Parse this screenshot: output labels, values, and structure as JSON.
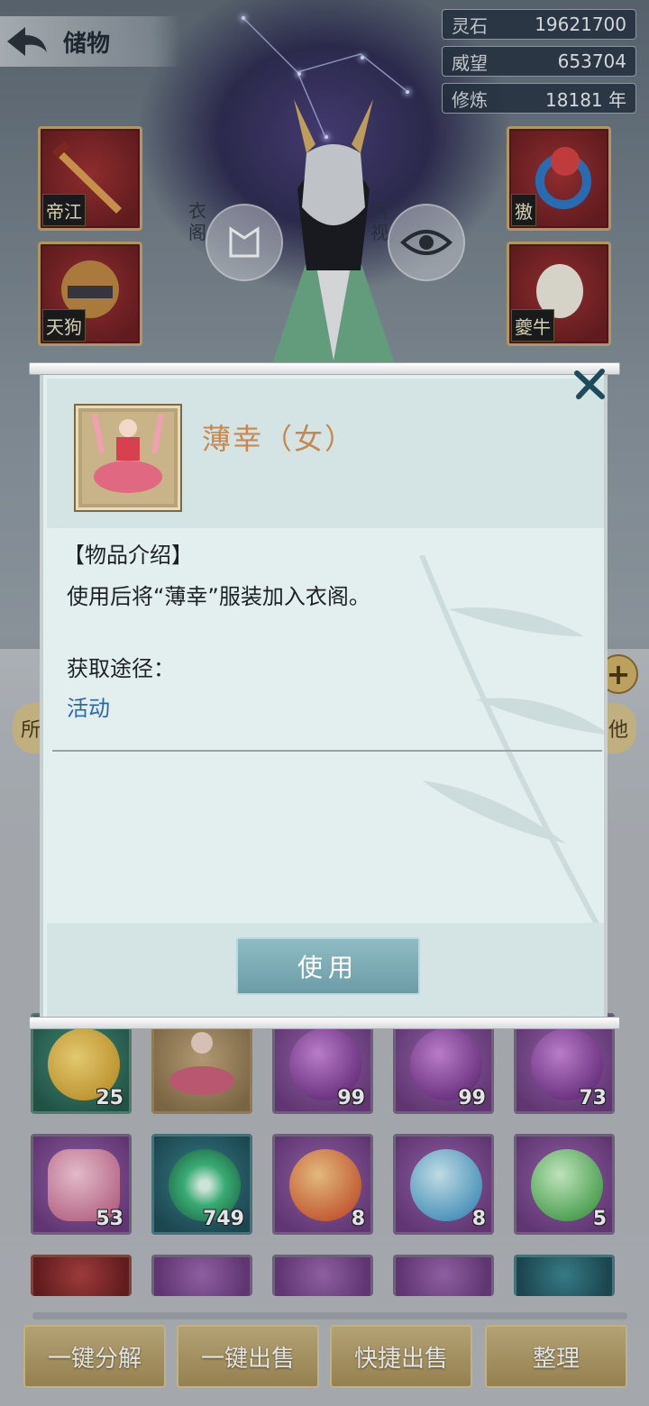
{
  "header": {
    "back_title": "储物"
  },
  "stats": [
    {
      "label": "灵石",
      "value": "19621700"
    },
    {
      "label": "威望",
      "value": "653704"
    },
    {
      "label": "修炼",
      "value": "18181 年"
    }
  ],
  "equipment": {
    "left": [
      {
        "badge": "帝江"
      },
      {
        "badge": "天狗"
      }
    ],
    "right": [
      {
        "badge": "獓"
      },
      {
        "badge": "夔牛"
      }
    ]
  },
  "character": {
    "wardrobe_label": "衣阁",
    "inner_view_label": "内视"
  },
  "inventory": {
    "tab_left_partial": "所",
    "tab_right_partial": "他",
    "rows": [
      [
        {
          "count": "25",
          "style": "green"
        },
        {
          "count": "",
          "style": "tan"
        },
        {
          "count": "99",
          "style": "purple"
        },
        {
          "count": "99",
          "style": "purple"
        },
        {
          "count": "73",
          "style": "purple"
        }
      ],
      [
        {
          "count": "53",
          "style": "purple"
        },
        {
          "count": "749",
          "style": "teal"
        },
        {
          "count": "8",
          "style": "purple"
        },
        {
          "count": "8",
          "style": "purple"
        },
        {
          "count": "5",
          "style": "purple"
        }
      ]
    ]
  },
  "bottom_buttons": [
    "一键分解",
    "一键出售",
    "快捷出售",
    "整理"
  ],
  "modal": {
    "item_name": "薄幸（女）",
    "section_title": "【物品介绍】",
    "description": "使用后将“薄幸”服装加入衣阁。",
    "acquire_title": "获取途径：",
    "acquire_source": "活动",
    "use_label": "使用"
  },
  "colors": {
    "item_name": "#c8874c",
    "link": "#2a69a4",
    "use_button": "#7fadb6"
  }
}
